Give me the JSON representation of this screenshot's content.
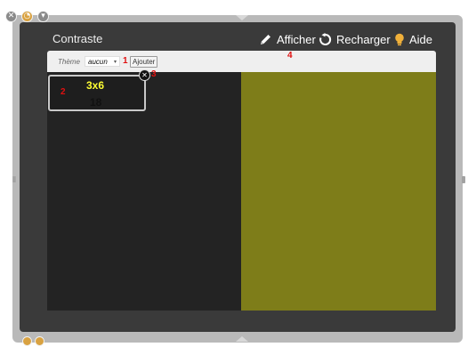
{
  "window": {
    "controls": [
      {
        "name": "close",
        "glyph": "✕"
      },
      {
        "name": "options",
        "glyph": "◔"
      },
      {
        "name": "collapse",
        "glyph": "▾"
      }
    ]
  },
  "header": {
    "title": "Contraste",
    "buttons": [
      {
        "label": "Afficher",
        "icon": "pencil-icon"
      },
      {
        "label": "Recharger",
        "icon": "reload-icon"
      },
      {
        "label": "Aide",
        "icon": "bulb-icon"
      }
    ]
  },
  "toolbar": {
    "theme_label": "Thème",
    "theme_value": "aucun",
    "select_arrow": "▾",
    "add_label": "Ajouter"
  },
  "card": {
    "title": "3x6",
    "value": "18",
    "close_glyph": "✕"
  },
  "annotations": [
    "1",
    "2",
    "3",
    "4"
  ],
  "colors": {
    "app_background": "#3a3a3a",
    "left_panel": "#232323",
    "right_panel": "#7e7d19",
    "card_title": "#ffff33",
    "annotation": "#e01010"
  }
}
